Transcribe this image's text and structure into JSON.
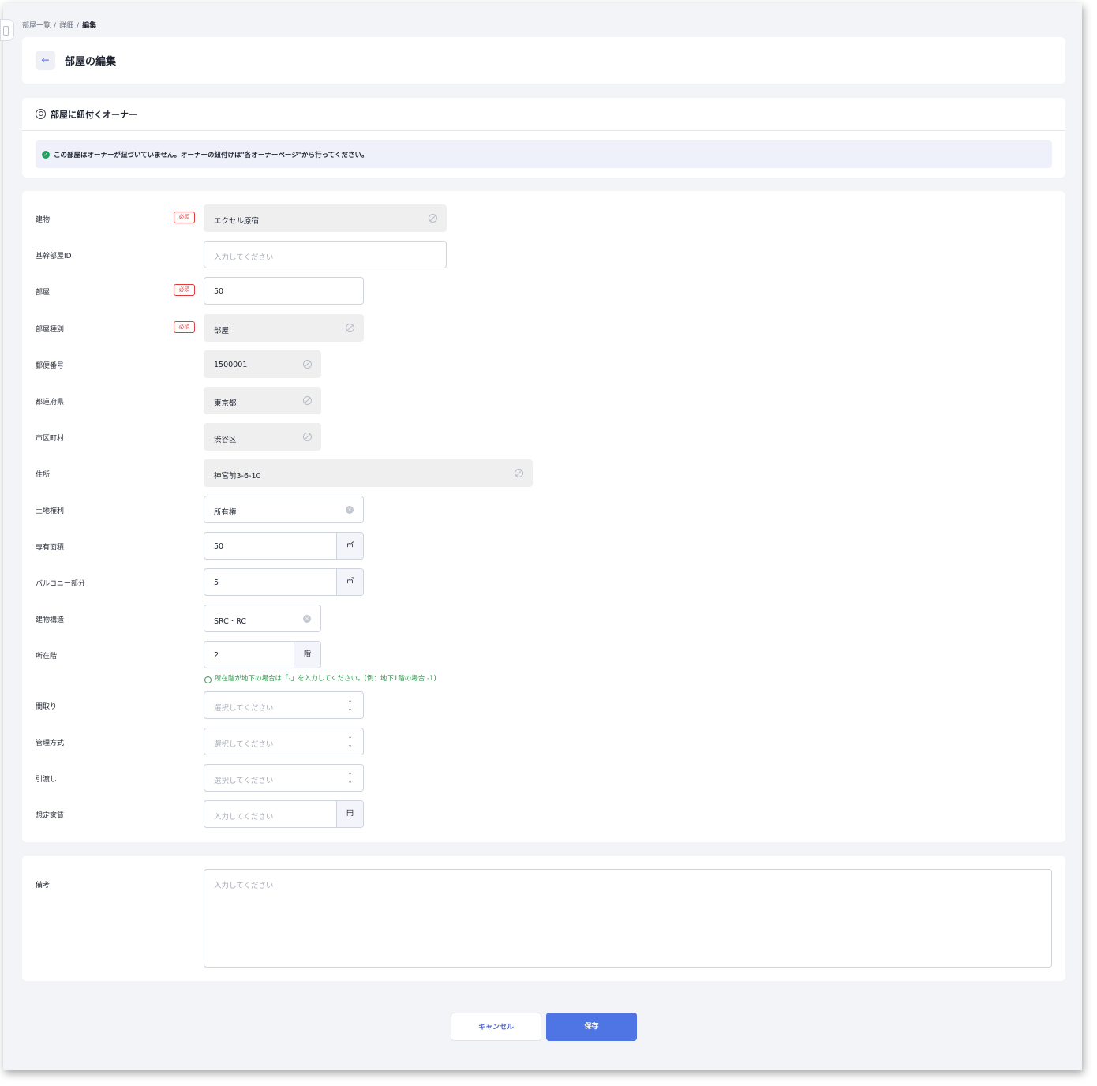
{
  "breadcrumb": {
    "item1": "部屋一覧",
    "sep": "/",
    "item2": "詳細",
    "current": "編集"
  },
  "header": {
    "back_icon": "←",
    "title": "部屋の編集"
  },
  "owner": {
    "title": "部屋に紐付くオーナー",
    "alert": "この部屋はオーナーが紐づいていません。オーナーの紐付けは\"各オーナーページ\"から行ってください。"
  },
  "required_label": "必須",
  "form": {
    "building": {
      "label": "建物",
      "value": "エクセル原宿"
    },
    "core_room_id": {
      "label": "基幹部屋ID",
      "placeholder": "入力してください"
    },
    "room": {
      "label": "部屋",
      "value": "50"
    },
    "room_type": {
      "label": "部屋種別",
      "value": "部屋"
    },
    "postal": {
      "label": "郵便番号",
      "value": "1500001"
    },
    "prefecture": {
      "label": "都道府県",
      "value": "東京都"
    },
    "city": {
      "label": "市区町村",
      "value": "渋谷区"
    },
    "address": {
      "label": "住所",
      "value": "神宮前3-6-10"
    },
    "land_right": {
      "label": "土地権利",
      "value": "所有権"
    },
    "area": {
      "label": "専有面積",
      "value": "50",
      "unit": "㎡"
    },
    "balcony": {
      "label": "バルコニー部分",
      "value": "5",
      "unit": "㎡"
    },
    "structure": {
      "label": "建物構造",
      "value": "SRC・RC"
    },
    "floor": {
      "label": "所在階",
      "value": "2",
      "unit": "階",
      "hint": "所在階が地下の場合は「-」を入力してください。(例：地下1階の場合 -1)"
    },
    "layout": {
      "label": "間取り",
      "placeholder": "選択してください"
    },
    "management": {
      "label": "管理方式",
      "placeholder": "選択してください"
    },
    "handover": {
      "label": "引渡し",
      "placeholder": "選択してください"
    },
    "rent": {
      "label": "想定家賃",
      "placeholder": "入力してください",
      "unit": "円"
    }
  },
  "notes": {
    "label": "備考",
    "placeholder": "入力してください"
  },
  "actions": {
    "cancel": "キャンセル",
    "save": "保存"
  },
  "colors": {
    "primary": "#4f74e3",
    "required": "#e03c3c",
    "hint": "#2c9a4e",
    "success": "#22a060"
  }
}
